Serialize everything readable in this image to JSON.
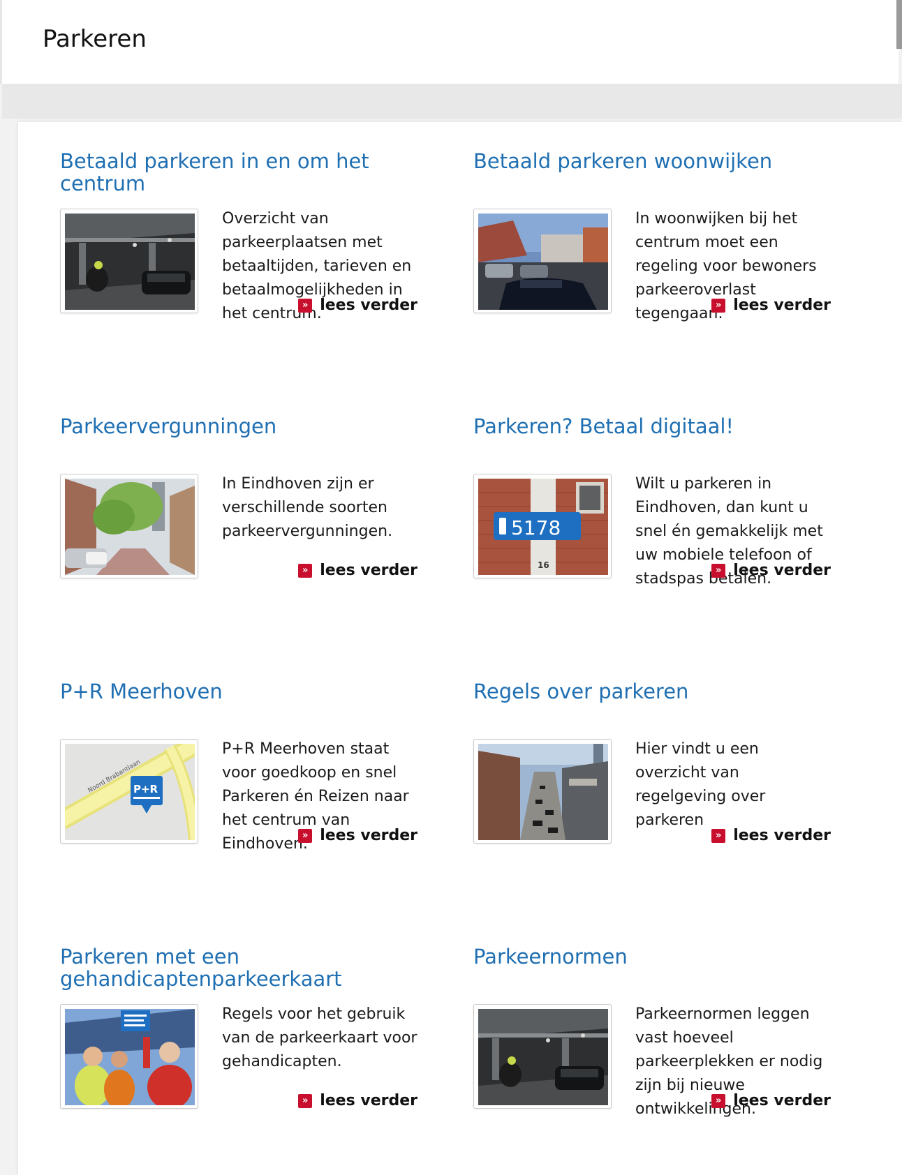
{
  "page": {
    "title": "Parkeren"
  },
  "colors": {
    "link": "#1f6fb2",
    "accent": "#c8102e"
  },
  "cards": [
    {
      "title": "Betaald parkeren in en om het centrum",
      "description": "Overzicht van parkeerplaatsen met betaaltijden, tarieven en betaalmogelijkheden in het centrum.",
      "read_more": "lees verder",
      "image": "parking-garage-photo"
    },
    {
      "title": "Betaald parkeren woonwijken",
      "description": "In woonwijken bij het centrum moet een regeling voor bewoners parkeeroverlast tegengaan.",
      "read_more": "lees verder",
      "image": "residential-street-photo"
    },
    {
      "title": "Parkeervergunningen",
      "description": "In Eindhoven zijn er verschillende soorten parkeervergunningen.",
      "read_more": "lees verder",
      "image": "city-street-photo"
    },
    {
      "title": "Parkeren? Betaal digitaal!",
      "description": "Wilt u parkeren in Eindhoven, dan kunt u snel én gemakkelijk met uw mobiele telefoon of stadspas betalen.",
      "read_more": "lees verder",
      "image": "parking-zone-sign-photo",
      "image_label": "5178",
      "image_sublabel": "16"
    },
    {
      "title": "P+R Meerhoven",
      "description": "P+R Meerhoven staat voor goedkoop en snel Parkeren én Reizen naar het centrum van Eindhoven.",
      "read_more": "lees verder",
      "image": "map-icon",
      "image_label": "P+R",
      "image_road": "Noord Brabantlaan"
    },
    {
      "title": "Regels over parkeren",
      "description": "Hier vindt u een overzicht van regelgeving over parkeren",
      "read_more": "lees verder",
      "image": "city-aerial-photo"
    },
    {
      "title": "Parkeren met een gehandicaptenparkeerkaart",
      "description": "Regels voor het gebruik van de parkeerkaart voor gehandicapten.",
      "read_more": "lees verder",
      "image": "disabled-parking-photo"
    },
    {
      "title": "Parkeernormen",
      "description": "Parkeernormen leggen vast hoeveel parkeerplekken er nodig zijn bij nieuwe ontwikkelingen.",
      "read_more": "lees verder",
      "image": "parking-garage-photo"
    }
  ]
}
